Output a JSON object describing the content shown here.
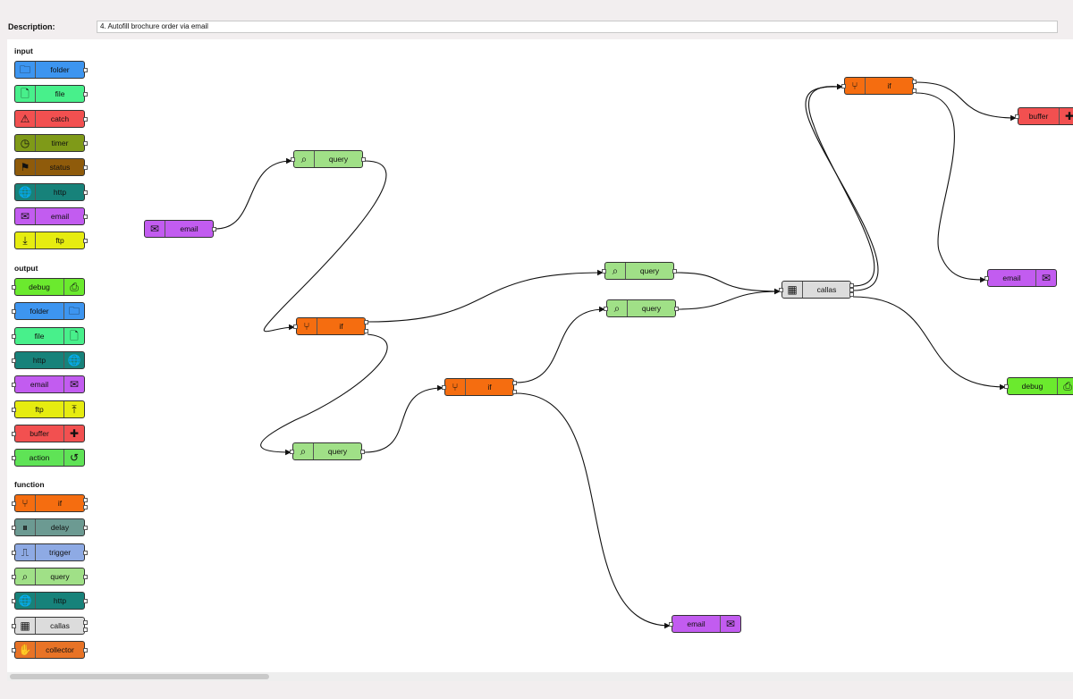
{
  "description": {
    "label": "Description:",
    "value": "4. Autofill brochure order via email"
  },
  "palette": {
    "sections": [
      {
        "title": "input",
        "items": [
          {
            "label": "folder",
            "color": "#3d95f0",
            "icon": "folder-icon",
            "glyph": "🗀",
            "icon_side": "left"
          },
          {
            "label": "file",
            "color": "#48f08b",
            "icon": "file-icon",
            "glyph": "🗋",
            "icon_side": "left"
          },
          {
            "label": "catch",
            "color": "#f25050",
            "icon": "warning-icon",
            "glyph": "⚠",
            "icon_side": "left"
          },
          {
            "label": "timer",
            "color": "#7f9a18",
            "icon": "clock-icon",
            "glyph": "◷",
            "icon_side": "left"
          },
          {
            "label": "status",
            "color": "#8f5b0b",
            "icon": "flag-icon",
            "glyph": "⚑",
            "icon_side": "left"
          },
          {
            "label": "http",
            "color": "#17827a",
            "icon": "globe-icon",
            "glyph": "🌐",
            "icon_side": "left"
          },
          {
            "label": "email",
            "color": "#c25cf0",
            "icon": "envelope-icon",
            "glyph": "✉",
            "icon_side": "left"
          },
          {
            "label": "ftp",
            "color": "#e6ec10",
            "icon": "download-icon",
            "glyph": "⤓",
            "icon_side": "left"
          }
        ]
      },
      {
        "title": "output",
        "items": [
          {
            "label": "debug",
            "color": "#6bea2e",
            "icon": "printer-icon",
            "glyph": "⎙",
            "icon_side": "right"
          },
          {
            "label": "folder",
            "color": "#3d95f0",
            "icon": "folder-icon",
            "glyph": "🗀",
            "icon_side": "right"
          },
          {
            "label": "file",
            "color": "#48f08b",
            "icon": "file-icon",
            "glyph": "🗋",
            "icon_side": "right"
          },
          {
            "label": "http",
            "color": "#17827a",
            "icon": "globe-icon",
            "glyph": "🌐",
            "icon_side": "right"
          },
          {
            "label": "email",
            "color": "#c25cf0",
            "icon": "envelope-icon",
            "glyph": "✉",
            "icon_side": "right"
          },
          {
            "label": "ftp",
            "color": "#e6ec10",
            "icon": "upload-icon",
            "glyph": "⤒",
            "icon_side": "right"
          },
          {
            "label": "buffer",
            "color": "#f25050",
            "icon": "puzzle-icon",
            "glyph": "✚",
            "icon_side": "right"
          },
          {
            "label": "action",
            "color": "#5fe356",
            "icon": "undo-icon",
            "glyph": "↺",
            "icon_side": "right"
          }
        ]
      },
      {
        "title": "function",
        "items": [
          {
            "label": "if",
            "color": "#f56d10",
            "icon": "branch-icon",
            "glyph": "⑂",
            "icon_side": "left"
          },
          {
            "label": "delay",
            "color": "#6c9a92",
            "icon": "pause-icon",
            "glyph": "⏸",
            "icon_side": "left"
          },
          {
            "label": "trigger",
            "color": "#8eaae4",
            "icon": "pulse-icon",
            "glyph": "⎍",
            "icon_side": "left"
          },
          {
            "label": "query",
            "color": "#a0e087",
            "icon": "search-icon",
            "glyph": "⌕",
            "icon_side": "left"
          },
          {
            "label": "http",
            "color": "#17827a",
            "icon": "globe-icon",
            "glyph": "🌐",
            "icon_side": "left"
          },
          {
            "label": "callas",
            "color": "#dcdcdc",
            "icon": "calculator-icon",
            "glyph": "▦",
            "icon_side": "left"
          },
          {
            "label": "collector",
            "color": "#e87326",
            "icon": "hand-icon",
            "glyph": "✋",
            "icon_side": "left"
          }
        ]
      }
    ]
  },
  "canvas": {
    "nodes": [
      {
        "label": "email",
        "color": "#c25cf0",
        "icon": "envelope-icon",
        "glyph": "✉",
        "icon_side": "left"
      },
      {
        "label": "query",
        "color": "#a0e087",
        "icon": "search-icon",
        "glyph": "⌕",
        "icon_side": "left"
      },
      {
        "label": "if",
        "color": "#f56d10",
        "icon": "branch-icon",
        "glyph": "⑂",
        "icon_side": "left"
      },
      {
        "label": "query",
        "color": "#a0e087",
        "icon": "search-icon",
        "glyph": "⌕",
        "icon_side": "left"
      },
      {
        "label": "if",
        "color": "#f56d10",
        "icon": "branch-icon",
        "glyph": "⑂",
        "icon_side": "left"
      },
      {
        "label": "query",
        "color": "#a0e087",
        "icon": "search-icon",
        "glyph": "⌕",
        "icon_side": "left"
      },
      {
        "label": "query",
        "color": "#a0e087",
        "icon": "search-icon",
        "glyph": "⌕",
        "icon_side": "left"
      },
      {
        "label": "callas",
        "color": "#dcdcdc",
        "icon": "calculator-icon",
        "glyph": "▦",
        "icon_side": "left"
      },
      {
        "label": "if",
        "color": "#f56d10",
        "icon": "branch-icon",
        "glyph": "⑂",
        "icon_side": "left"
      },
      {
        "label": "buffer",
        "color": "#f25050",
        "icon": "puzzle-icon",
        "glyph": "✚",
        "icon_side": "right"
      },
      {
        "label": "email",
        "color": "#c25cf0",
        "icon": "envelope-icon",
        "glyph": "✉",
        "icon_side": "right"
      },
      {
        "label": "debug",
        "color": "#6bea2e",
        "icon": "printer-icon",
        "glyph": "⎙",
        "icon_side": "right"
      },
      {
        "label": "email",
        "color": "#c25cf0",
        "icon": "envelope-icon",
        "glyph": "✉",
        "icon_side": "right"
      }
    ]
  }
}
